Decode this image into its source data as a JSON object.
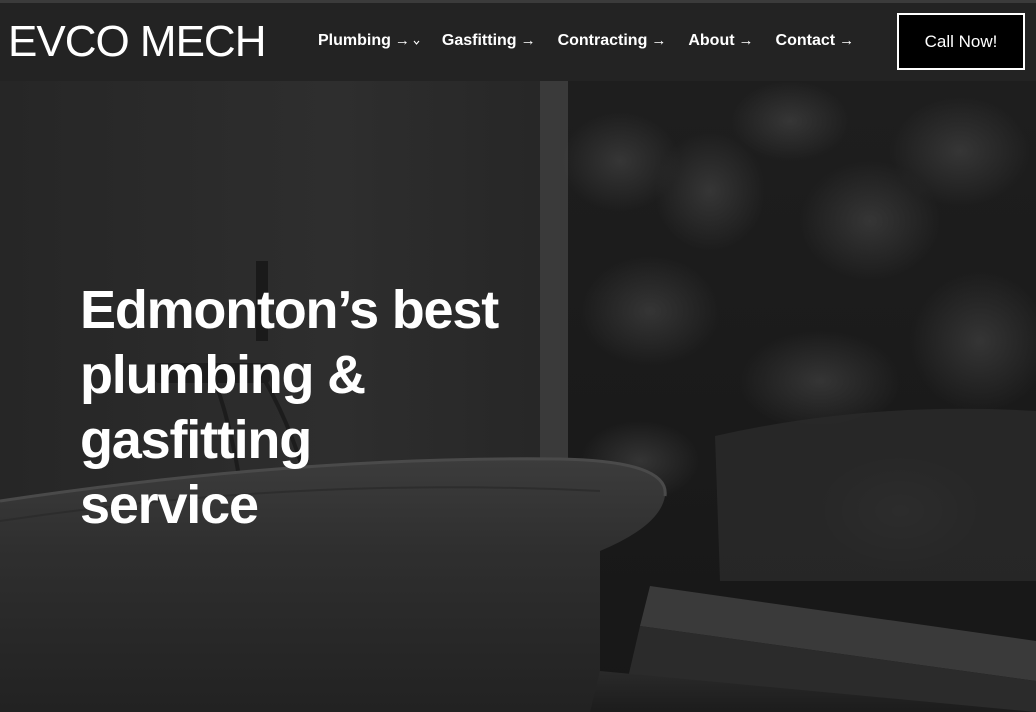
{
  "header": {
    "logo": "EVCO MECH",
    "nav": [
      {
        "label": "Plumbing",
        "arrow": "→",
        "has_dropdown": true
      },
      {
        "label": "Gasfitting",
        "arrow": "→",
        "has_dropdown": false
      },
      {
        "label": "Contracting",
        "arrow": "→",
        "has_dropdown": false
      },
      {
        "label": "About",
        "arrow": "→",
        "has_dropdown": false
      },
      {
        "label": "Contact",
        "arrow": "→",
        "has_dropdown": false
      }
    ],
    "cta_label": "Call Now!"
  },
  "hero": {
    "heading": "Edmonton’s best plumbing & gasfitting service",
    "background_image": "bathtub-by-window-photo"
  },
  "colors": {
    "header_bg": "#232323",
    "page_bg": "#1c1c1c",
    "text": "#ffffff",
    "cta_bg": "#000000",
    "cta_border": "#ffffff"
  }
}
